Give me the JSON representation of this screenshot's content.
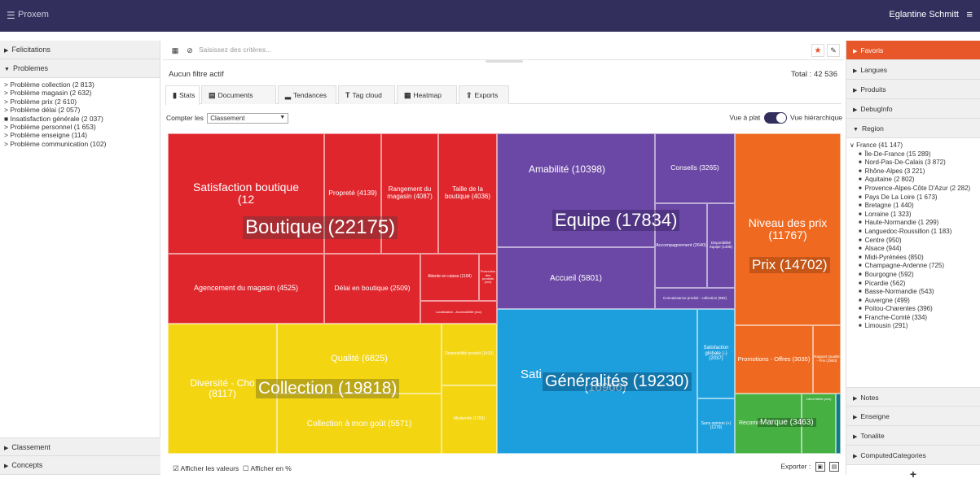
{
  "topbar": {
    "brand": "Proxem",
    "user": "Eglantine Schmitt",
    "menu_icon": "hamburger-icon"
  },
  "left": {
    "sections_top": [
      {
        "label": "Felicitations",
        "expanded": false
      },
      {
        "label": "Problemes",
        "expanded": true
      }
    ],
    "problemes": [
      {
        "label": "> Problème collection (2 813)"
      },
      {
        "label": "> Problème magasin (2 632)"
      },
      {
        "label": "> Problème prix (2 610)"
      },
      {
        "label": "> Problème délai (2 057)"
      },
      {
        "label": "■ Insatisfaction générale (2 037)"
      },
      {
        "label": "> Problème personnel (1 653)"
      },
      {
        "label": "> Problème enseigne (114)"
      },
      {
        "label": "> Problème communication (102)"
      }
    ],
    "sections_bottom": [
      {
        "label": "Classement"
      },
      {
        "label": "Concepts"
      }
    ]
  },
  "search": {
    "placeholder": "Saisissez des critères..."
  },
  "filter": {
    "label": "Aucun filtre actif",
    "total": "Total : 42 536"
  },
  "tabs": [
    {
      "label": "Stats",
      "icon": "bar-chart-icon",
      "active": true
    },
    {
      "label": "Documents",
      "icon": "documents-icon"
    },
    {
      "label": "Tendances",
      "icon": "trend-icon"
    },
    {
      "label": "Tag cloud",
      "icon": "text-height-icon"
    },
    {
      "label": "Heatmap",
      "icon": "grid-icon"
    },
    {
      "label": "Exports",
      "icon": "export-icon"
    }
  ],
  "compter": {
    "label": "Compter les",
    "value": "Classement"
  },
  "vue": {
    "left": "Vue à plat",
    "right": "Vue hiérarchique"
  },
  "treemap": {
    "groups": [
      {
        "label": "Boutique (22175)",
        "color": "#e0262d"
      },
      {
        "label": "Equipe (17834)",
        "color": "#6b47a6"
      },
      {
        "label": "Prix (14702)",
        "color": "#ef6a20"
      },
      {
        "label": "Collection (19818)",
        "color": "#f4d512"
      },
      {
        "label": "Généralités (19230)",
        "color": "#1d9fde"
      },
      {
        "label": "Marque (3463)",
        "color": "#46b042"
      }
    ],
    "cells": {
      "satisfaction_boutique": "Satisfaction boutique",
      "satisfaction_boutique_val": "(12",
      "proprete": "Propreté (4139)",
      "rangement": "Rangement du magasin (4087)",
      "taille": "Taille de la boutique (4036)",
      "agencement": "Agencement du magasin (4525)",
      "delai": "Délai en boutique (2509)",
      "attente": "Attente en caisse (1168)",
      "promotion_produits": "Promotion des produits (xxx)",
      "localisation": "Localisation - Accessibilité (xxx)",
      "amabilite": "Amabilité (10398)",
      "conseils": "Conseils (3265)",
      "accompagnement": "Accompagnement (2640)",
      "disponibilite_equipe": "Disponibilité équipe (1408)",
      "accueil": "Accueil (5801)",
      "connaissance": "Connaissance produit - collection (982)",
      "niveau_prix": "Niveau des prix",
      "niveau_prix_val": "(11767)",
      "promotions": "Promotions - Offres (3035)",
      "rapport_qp": "Rapport Qualité - Prix (1900)",
      "diversite": "Diversité - Cho",
      "diversite_val": "(8117)",
      "qualite": "Qualité (6825)",
      "dispo_produit": "Disponibilité produit (1419)",
      "modernite": "Modernité (1783)",
      "collection_gout": "Collection à mon goût (5571)",
      "sati": "Sati",
      "sati_val": "(16966)",
      "satisfaction_globale": "Satisfaction globale (-) (2037)",
      "sans_opinion": "Sans opinion (+) (1279)",
      "recomm": "Recomm",
      "cher_fidele": "Client fidèle (xxx)"
    }
  },
  "bottombar": {
    "afficher_valeurs": "Afficher les valeurs",
    "afficher_pct": "Afficher en %",
    "exporter": "Exporter :"
  },
  "right": {
    "sections": [
      {
        "label": "Favoris",
        "active": true
      },
      {
        "label": "Langues"
      },
      {
        "label": "Produits"
      },
      {
        "label": "DebugInfo"
      },
      {
        "label": "Region",
        "expanded": true
      }
    ],
    "region_root": "France (41 147)",
    "regions": [
      "Île-De-France (15 289)",
      "Nord-Pas-De-Calais (3 872)",
      "Rhône-Alpes (3 221)",
      "Aquitaine (2 802)",
      "Provence-Alpes-Côte D'Azur (2 282)",
      "Pays De La Loire (1 673)",
      "Bretagne (1 440)",
      "Lorraine (1 323)",
      "Haute-Normandie (1 299)",
      "Languedoc-Roussillon (1 183)",
      "Centre (950)",
      "Alsace (944)",
      "Midi-Pyrénées (850)",
      "Champagne-Ardenne (725)",
      "Bourgogne (592)",
      "Picardie (562)",
      "Basse-Normandie (543)",
      "Auvergne (499)",
      "Poitou-Charentes (396)",
      "Franche-Comté (334)",
      "Limousin (291)"
    ],
    "sections_after": [
      {
        "label": "Notes"
      },
      {
        "label": "Enseigne"
      },
      {
        "label": "Tonalite"
      },
      {
        "label": "ComputedCategories"
      }
    ],
    "plus": "+"
  }
}
